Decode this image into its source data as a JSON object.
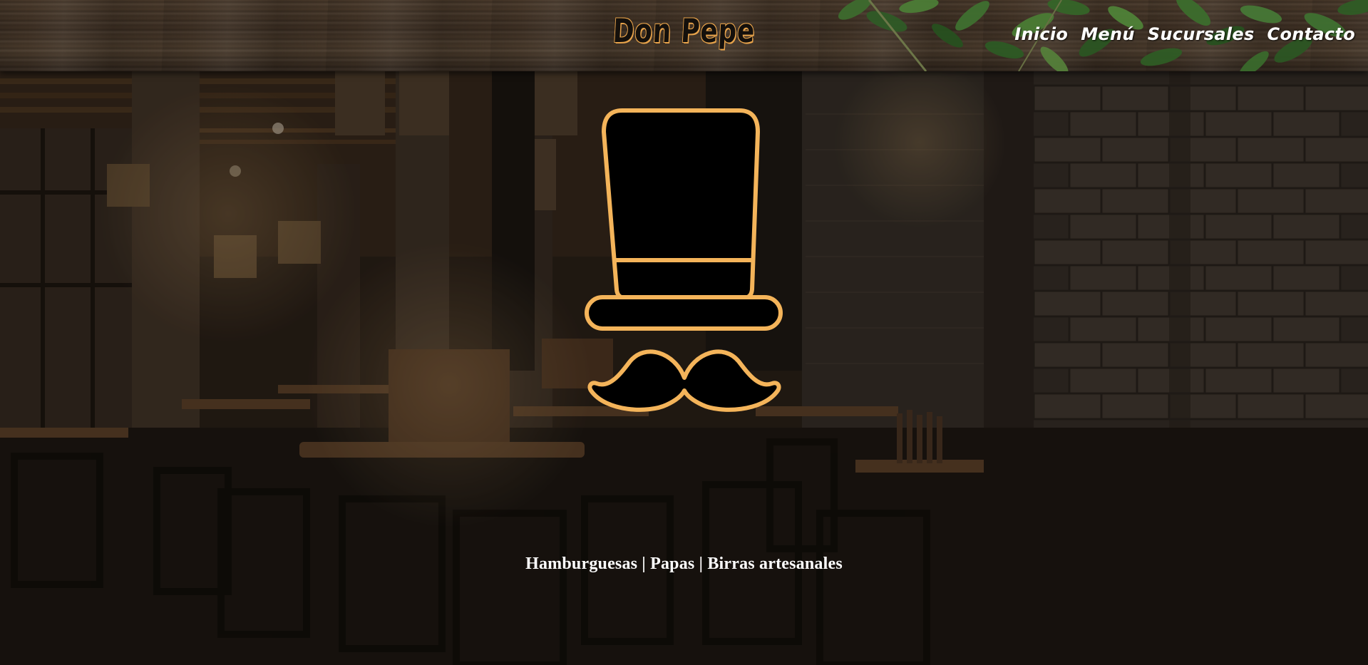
{
  "header": {
    "brand": "Don Pepe",
    "nav": [
      {
        "label": "Inicio"
      },
      {
        "label": "Menú"
      },
      {
        "label": "Sucursales"
      },
      {
        "label": "Contacto"
      }
    ]
  },
  "hero": {
    "tagline": "Hamburguesas | Papas | Birras artesanales",
    "logo_icon": "top-hat-mustache-icon"
  },
  "colors": {
    "accent": "#F4B45A",
    "text": "#FFFFFF",
    "logo_fill": "#000000"
  }
}
